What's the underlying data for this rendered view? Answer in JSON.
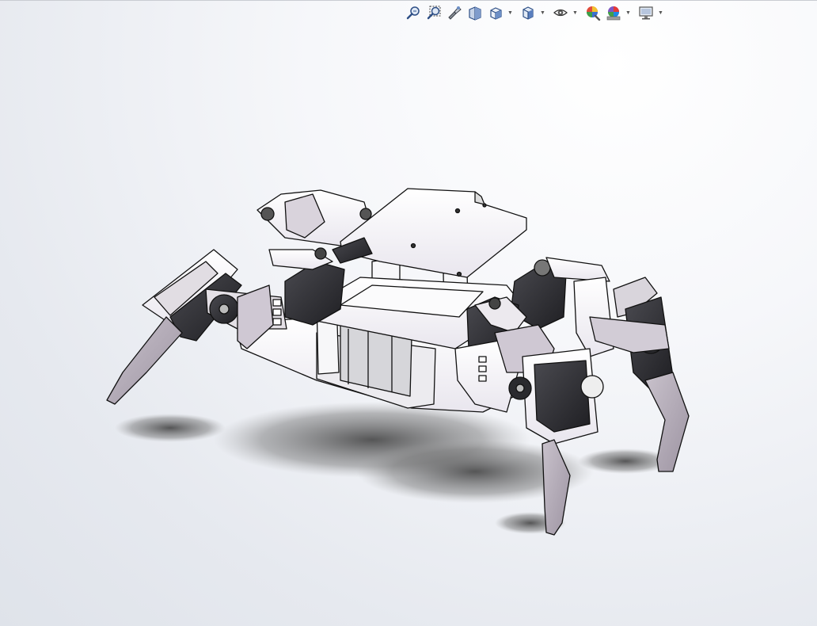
{
  "app": {
    "accent": "#6d8fc6",
    "background": "#eef0f4",
    "model_body_color": "#f4f3f6",
    "servo_color": "#2e2e32"
  },
  "toolbar": {
    "buttons": [
      {
        "name": "zoom-to-fit",
        "icon": "zoom-fit-icon",
        "has_dropdown": false
      },
      {
        "name": "zoom-to-area",
        "icon": "zoom-area-icon",
        "has_dropdown": false
      },
      {
        "name": "previous-view",
        "icon": "previous-view-icon",
        "has_dropdown": false
      },
      {
        "name": "section-view",
        "icon": "section-view-icon",
        "has_dropdown": false
      },
      {
        "name": "view-orientation",
        "icon": "view-orientation-icon",
        "has_dropdown": true
      },
      {
        "name": "display-style",
        "icon": "display-style-icon",
        "has_dropdown": true
      },
      {
        "name": "hide-show-items",
        "icon": "hide-show-icon",
        "has_dropdown": true
      },
      {
        "name": "edit-appearance",
        "icon": "edit-appearance-icon",
        "has_dropdown": false
      },
      {
        "name": "apply-scene",
        "icon": "apply-scene-icon",
        "has_dropdown": true
      },
      {
        "name": "view-settings",
        "icon": "monitor-icon",
        "has_dropdown": true
      }
    ]
  }
}
